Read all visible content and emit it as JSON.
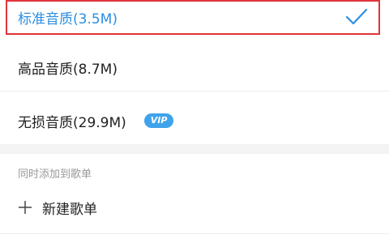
{
  "quality_options": {
    "standard": {
      "label": "标准音质(3.5M)",
      "selected": true
    },
    "high": {
      "label": "高品音质(8.7M)"
    },
    "lossless": {
      "label": "无损音质(29.9M)",
      "badge": "VIP"
    }
  },
  "playlist_section": {
    "title": "同时添加到歌单",
    "new_playlist_label": "新建歌单"
  },
  "colors": {
    "selected_text": "#2d8de0",
    "highlight_border": "#e0343a",
    "vip_badge": "#3fa3ec"
  },
  "icons": {
    "selected_check": "check-icon",
    "new_playlist": "plus-icon"
  }
}
